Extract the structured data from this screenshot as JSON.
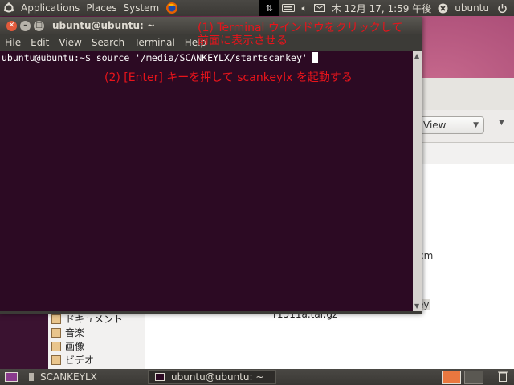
{
  "top_panel": {
    "menus": [
      "Applications",
      "Places",
      "System"
    ],
    "clock": "木 12月 17, 1:59 午後",
    "user": "ubuntu"
  },
  "terminal": {
    "title": "ubuntu@ubuntu: ~",
    "menus": [
      "File",
      "Edit",
      "View",
      "Search",
      "Terminal",
      "Help"
    ],
    "prompt_line": "ubuntu@ubuntu:~$ source '/media/SCANKEYLX/startscankey'"
  },
  "annotations": {
    "step1_line1": "(1) Terminal ウインドウをクリックして",
    "step1_line2": "前面に表示させる",
    "step2": "(2) [Enter] キーを押して scankeylx を起動する"
  },
  "file_manager": {
    "view_label": "View",
    "fragment_cm": "cm",
    "fragment_ey": "ey",
    "file_label": "r1511a.tar.gz",
    "side_items": [
      "ドキュメント",
      "音楽",
      "画像",
      "ビデオ"
    ]
  },
  "taskbar": {
    "items": [
      "SCANKEYLX",
      "ubuntu@ubuntu: ~"
    ]
  }
}
